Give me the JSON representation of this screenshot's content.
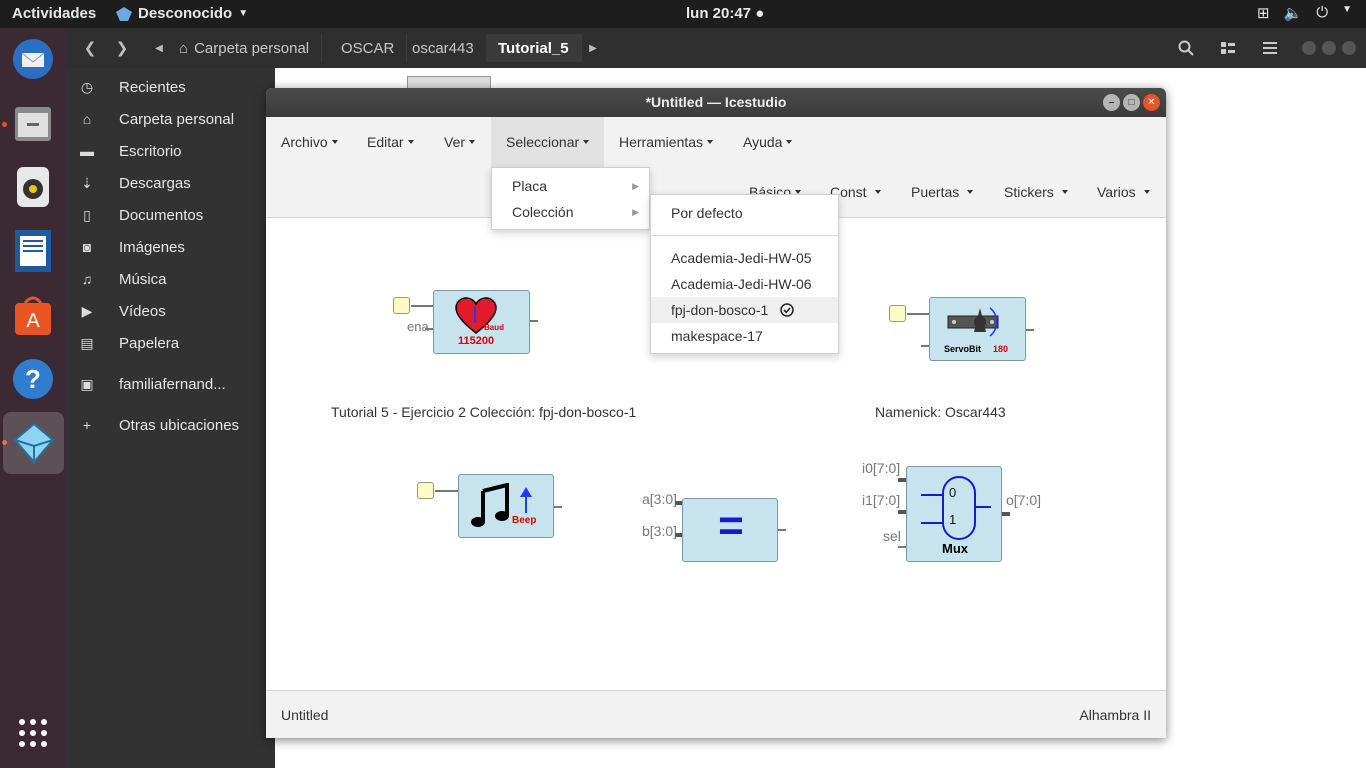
{
  "topbar": {
    "activities": "Actividades",
    "app_name": "Desconocido",
    "clock": "lun 20:47"
  },
  "dock": {
    "items": [
      {
        "name": "thunderbird-icon"
      },
      {
        "name": "files-icon"
      },
      {
        "name": "rhythmbox-icon"
      },
      {
        "name": "libreoffice-writer-icon"
      },
      {
        "name": "software-center-icon"
      },
      {
        "name": "help-icon"
      },
      {
        "name": "icestudio-icon"
      }
    ]
  },
  "file_manager": {
    "breadcrumbs": [
      "Carpeta personal",
      "OSCAR",
      "oscar443",
      "Tutorial_5"
    ],
    "sidebar": [
      {
        "label": "Recientes",
        "icon": "clock-icon"
      },
      {
        "label": "Carpeta personal",
        "icon": "home-icon"
      },
      {
        "label": "Escritorio",
        "icon": "folder-icon"
      },
      {
        "label": "Descargas",
        "icon": "download-icon"
      },
      {
        "label": "Documentos",
        "icon": "document-icon"
      },
      {
        "label": "Imágenes",
        "icon": "camera-icon"
      },
      {
        "label": "Música",
        "icon": "music-icon"
      },
      {
        "label": "Vídeos",
        "icon": "video-icon"
      },
      {
        "label": "Papelera",
        "icon": "trash-icon"
      },
      {
        "label": "familiafernand...",
        "icon": "network-drive-icon"
      },
      {
        "label": "Otras ubicaciones",
        "icon": "plus-icon"
      }
    ]
  },
  "icestudio": {
    "title": "*Untitled — Icestudio",
    "menu": [
      "Archivo",
      "Editar",
      "Ver",
      "Seleccionar",
      "Herramientas",
      "Ayuda"
    ],
    "toolbar": [
      "Básico",
      "Const",
      "Puertas",
      "Stickers",
      "Varios"
    ],
    "select_menu": {
      "items": [
        "Placa",
        "Colección"
      ]
    },
    "collection_submenu": {
      "items": [
        "Por defecto",
        "Academia-Jedi-HW-05",
        "Academia-Jedi-HW-06",
        "fpj-don-bosco-1",
        "makespace-17"
      ],
      "selected": "fpj-don-bosco-1"
    },
    "canvas": {
      "note_left": "Tutorial 5 - Ejercicio 2 Colección: fpj-don-bosco-1",
      "note_right": "Namenick: Oscar443",
      "serial_block": {
        "label_baud": "Baud",
        "value": "115200",
        "port": "ena"
      },
      "servo_block": {
        "label": "ServoBit",
        "value": "180"
      },
      "beep_block": {
        "label": "Beep"
      },
      "equal_block": {
        "symbol": "=",
        "in_a": "a[3:0]",
        "in_b": "b[3:0]"
      },
      "mux_block": {
        "label": "Mux",
        "in0": "i0[7:0]",
        "in1": "i1[7:0]",
        "sel": "sel",
        "out": "o[7:0]",
        "d0": "0",
        "d1": "1"
      }
    },
    "status": {
      "left": "Untitled",
      "right": "Alhambra II"
    }
  }
}
